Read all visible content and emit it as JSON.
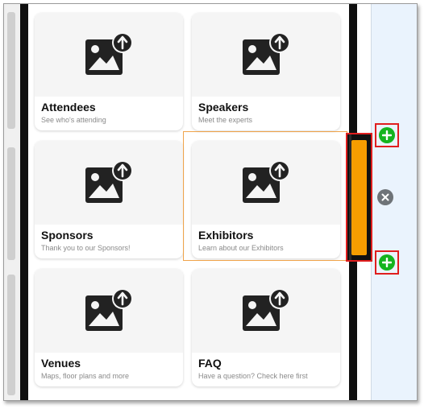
{
  "tiles": [
    {
      "title": "Attendees",
      "subtitle": "See who's attending",
      "icon": "image-upload-icon"
    },
    {
      "title": "Speakers",
      "subtitle": "Meet the experts",
      "icon": "image-upload-icon"
    },
    {
      "title": "Sponsors",
      "subtitle": "Thank you to our Sponsors!",
      "icon": "image-upload-icon"
    },
    {
      "title": "Exhibitors",
      "subtitle": "Learn about our Exhibitors",
      "icon": "image-upload-icon"
    },
    {
      "title": "Venues",
      "subtitle": "Maps, floor plans and more",
      "icon": "image-upload-icon"
    },
    {
      "title": "FAQ",
      "subtitle": "Have a question? Check here first",
      "icon": "image-upload-icon"
    }
  ],
  "controls": {
    "add_above_icon": "plus-icon",
    "remove_icon": "close-icon",
    "add_below_icon": "plus-icon"
  },
  "colors": {
    "selection_handle": "#f69d00",
    "add_button": "#14b41e",
    "highlight_box": "#e01e1e",
    "remove_button": "#6e7378"
  }
}
